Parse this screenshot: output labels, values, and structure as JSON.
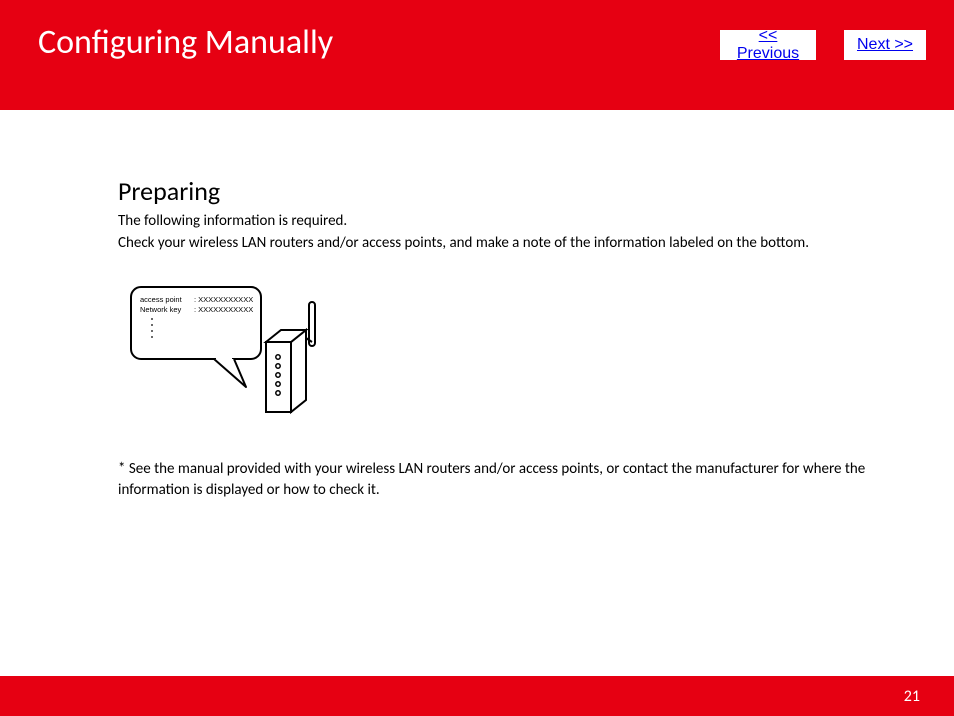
{
  "header": {
    "title": "Configuring Manually",
    "previous_label": "<< Previous",
    "next_label": "Next >>"
  },
  "content": {
    "section_title": "Preparing",
    "line1": "The following information is required.",
    "line2": "Check your wireless LAN routers and/or access points, and make a note of the information labeled on the bottom.",
    "note": "* See the manual provided with your wireless LAN routers and/or access points, or contact the manufacturer for where the information is displayed or how to check it."
  },
  "illustration": {
    "label_row1_left": "access point",
    "label_row1_right": ": XXXXXXXXXXX",
    "label_row2_left": "Network key",
    "label_row2_right": ": XXXXXXXXXXX"
  },
  "footer": {
    "page_number": "21"
  }
}
